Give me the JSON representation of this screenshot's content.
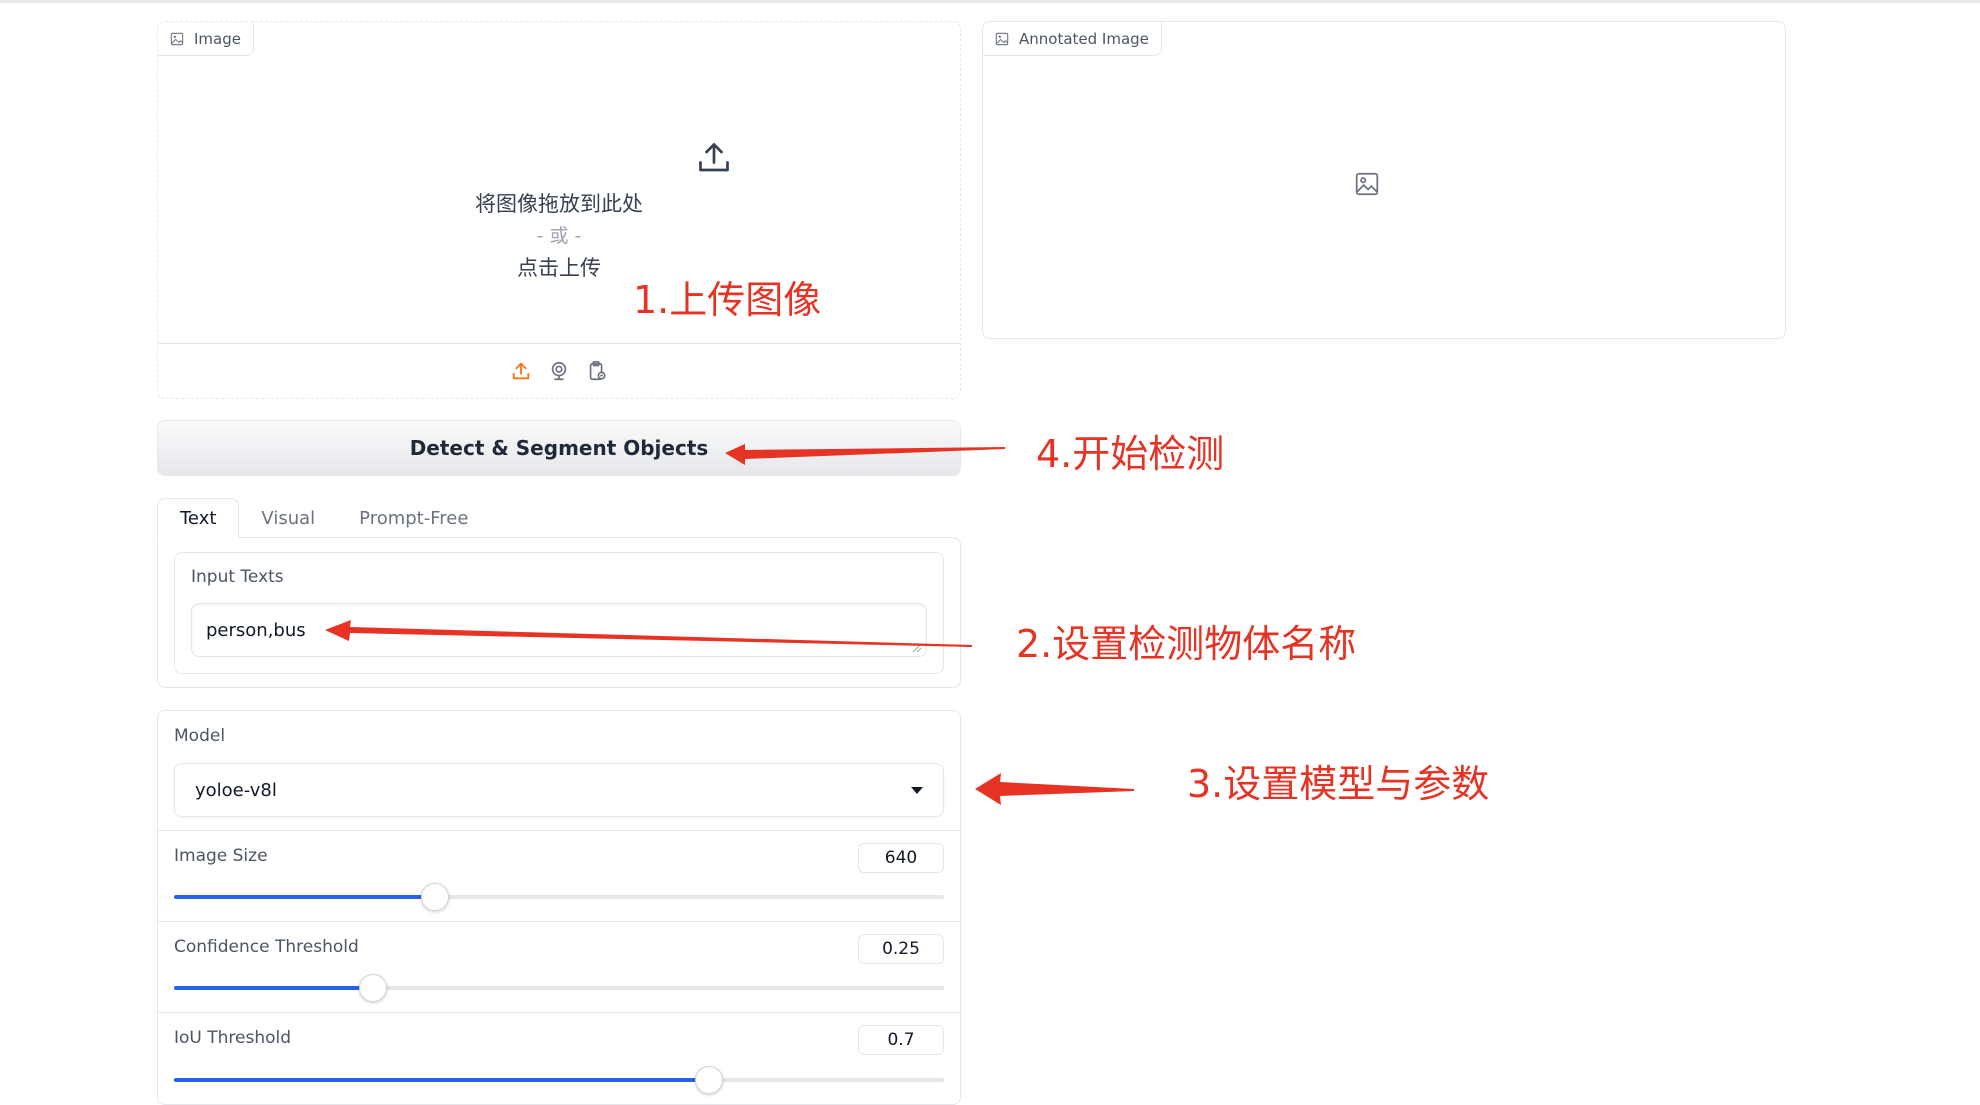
{
  "image_input": {
    "label": "Image",
    "drop_text": "将图像拖放到此处",
    "or_text": "- 或 -",
    "click_text": "点击上传",
    "sources": [
      "upload-icon",
      "webcam-icon",
      "clipboard-icon"
    ]
  },
  "output": {
    "label": "Annotated Image"
  },
  "detect_button": {
    "label": "Detect & Segment Objects"
  },
  "tabs": [
    {
      "label": "Text",
      "active": true
    },
    {
      "label": "Visual",
      "active": false
    },
    {
      "label": "Prompt-Free",
      "active": false
    }
  ],
  "text_prompt": {
    "label": "Input Texts",
    "value": "person,bus"
  },
  "model": {
    "label": "Model",
    "value": "yoloe-v8l"
  },
  "sliders": [
    {
      "label": "Image Size",
      "value": "640",
      "fraction": 0.338
    },
    {
      "label": "Confidence Threshold",
      "value": "0.25",
      "fraction": 0.257
    },
    {
      "label": "IoU Threshold",
      "value": "0.7",
      "fraction": 0.693
    }
  ],
  "annotations": {
    "step1": "1.上传图像",
    "step2": "2.设置检测物体名称",
    "step3": "3.设置模型与参数",
    "step4": "4.开始检测"
  },
  "colors": {
    "accent": "#2563eb",
    "annotation": "#e63323",
    "upload_icon": "#f97316"
  }
}
